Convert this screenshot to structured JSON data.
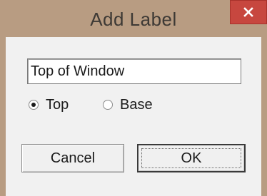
{
  "window": {
    "title": "Add Label",
    "close_icon": "close-icon"
  },
  "dialog": {
    "label_value": "Top of Window",
    "radio_top": {
      "label": "Top",
      "checked": true
    },
    "radio_base": {
      "label": "Base",
      "checked": false
    },
    "cancel_label": "Cancel",
    "ok_label": "OK"
  },
  "colors": {
    "titlebar": "#b89c82",
    "close_button": "#c7473f",
    "client_background": "#f1f1f1"
  }
}
